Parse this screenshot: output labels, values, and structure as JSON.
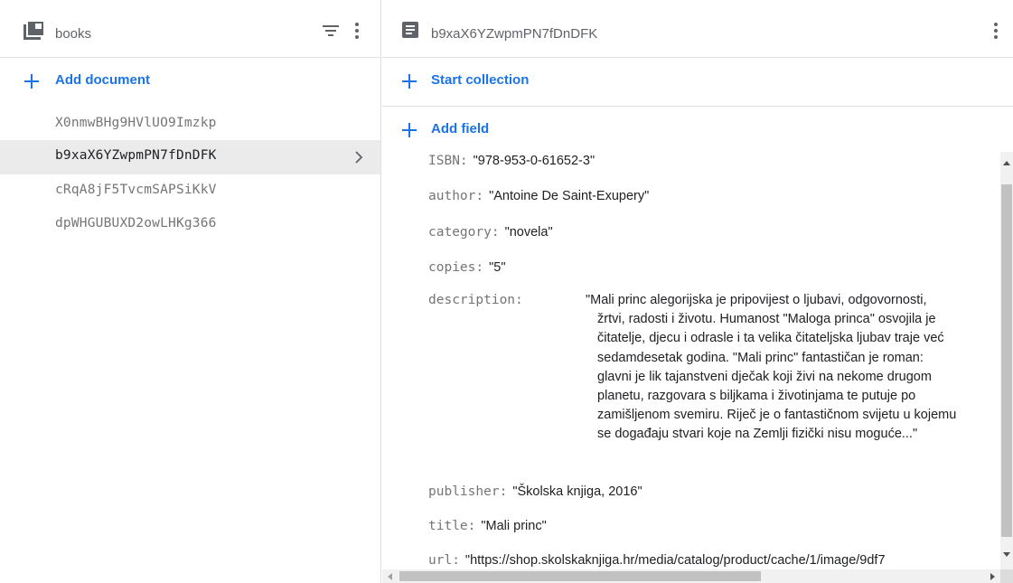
{
  "colors": {
    "accent": "#1a73e8",
    "selected_bg": "#ebebeb",
    "muted_text": "#5f6368",
    "key_text": "#757575"
  },
  "collection": {
    "title": "books",
    "icon": "collection-icon",
    "add_document_label": "Add document",
    "documents": [
      "X0nmwBHg9HVlUO9Imzkp",
      "b9xaX6YZwpmPN7fDnDFK",
      "cRqA8jF5TvcmSAPSiKkV",
      "dpWHGUBUXD2owLHKg366"
    ],
    "selected_index": 1
  },
  "document": {
    "title": "b9xaX6YZwpmPN7fDnDFK",
    "icon": "document-icon",
    "start_collection_label": "Start collection",
    "add_field_label": "Add field",
    "fields": {
      "isbn": {
        "key": "ISBN:",
        "value": "\"978-953-0-61652-3\""
      },
      "author": {
        "key": "author:",
        "value": "\"Antoine De Saint-Exupery\""
      },
      "category": {
        "key": "category:",
        "value": "\"novela\""
      },
      "copies": {
        "key": "copies:",
        "value": "\"5\""
      },
      "description": {
        "key": "description:",
        "lines": [
          "\"Mali princ alegorijska je pripovijest o ljubavi, odgovornosti,",
          "žrtvi, radosti i životu. Humanost \"Maloga princa\" osvojila je",
          "čitatelje, djecu i odrasle i ta velika čitateljska ljubav traje već",
          "sedamdesetak godina. \"Mali princ\" fantastičan je roman:",
          "glavni je lik tajanstveni dječak koji živi na nekome drugom",
          "planetu, razgovara s biljkama i životinjama te putuje po",
          "zamišljenom svemiru. Riječ je o fantastičnom svijetu u kojemu",
          "se događaju stvari koje na Zemlji fizički nisu moguće...\""
        ]
      },
      "publisher": {
        "key": "publisher:",
        "value": "\"Školska knjiga, 2016\""
      },
      "title": {
        "key": "title:",
        "value": "\"Mali princ\""
      },
      "url": {
        "key": "url:",
        "value": "\"https://shop.skolskaknjiga.hr/media/catalog/product/cache/1/image/9df7"
      }
    }
  }
}
